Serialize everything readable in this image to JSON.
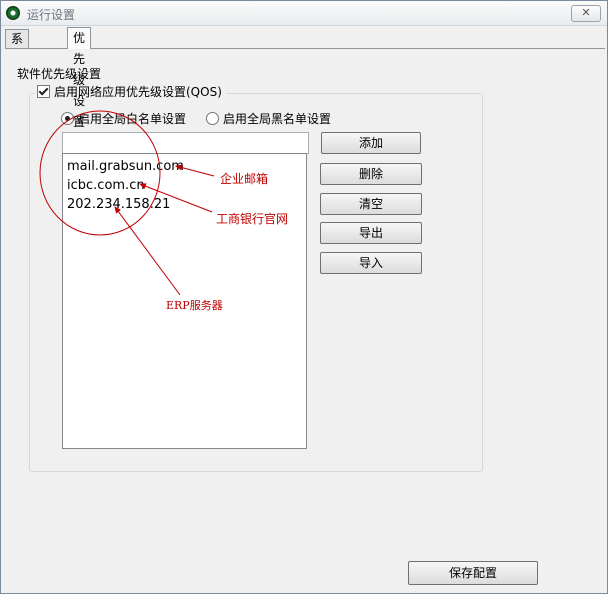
{
  "window": {
    "title": "运行设置",
    "close_label": "✕"
  },
  "tabs": [
    {
      "label": "系统设置"
    },
    {
      "label": "优先级设置"
    }
  ],
  "section_label": "软件优先级设置",
  "qos_checkbox": {
    "label": "启用网络应用优先级设置(QOS)",
    "checked": true
  },
  "radios": [
    {
      "label": "启用全局白名单设置",
      "selected": true
    },
    {
      "label": "启用全局黑名单设置",
      "selected": false
    }
  ],
  "input": {
    "value": ""
  },
  "list": {
    "items": [
      "mail.grabsun.com",
      "icbc.com.cn",
      "202.234.158.21"
    ]
  },
  "buttons": {
    "add": "添加",
    "delete": "删除",
    "clear": "清空",
    "export": "导出",
    "import": "导入"
  },
  "save_button": "保存配置",
  "annotations": {
    "mail": "企业邮箱",
    "bank": "工商银行官网",
    "erp": "ERP服务器"
  },
  "colors": {
    "annotation": "#c00000"
  }
}
